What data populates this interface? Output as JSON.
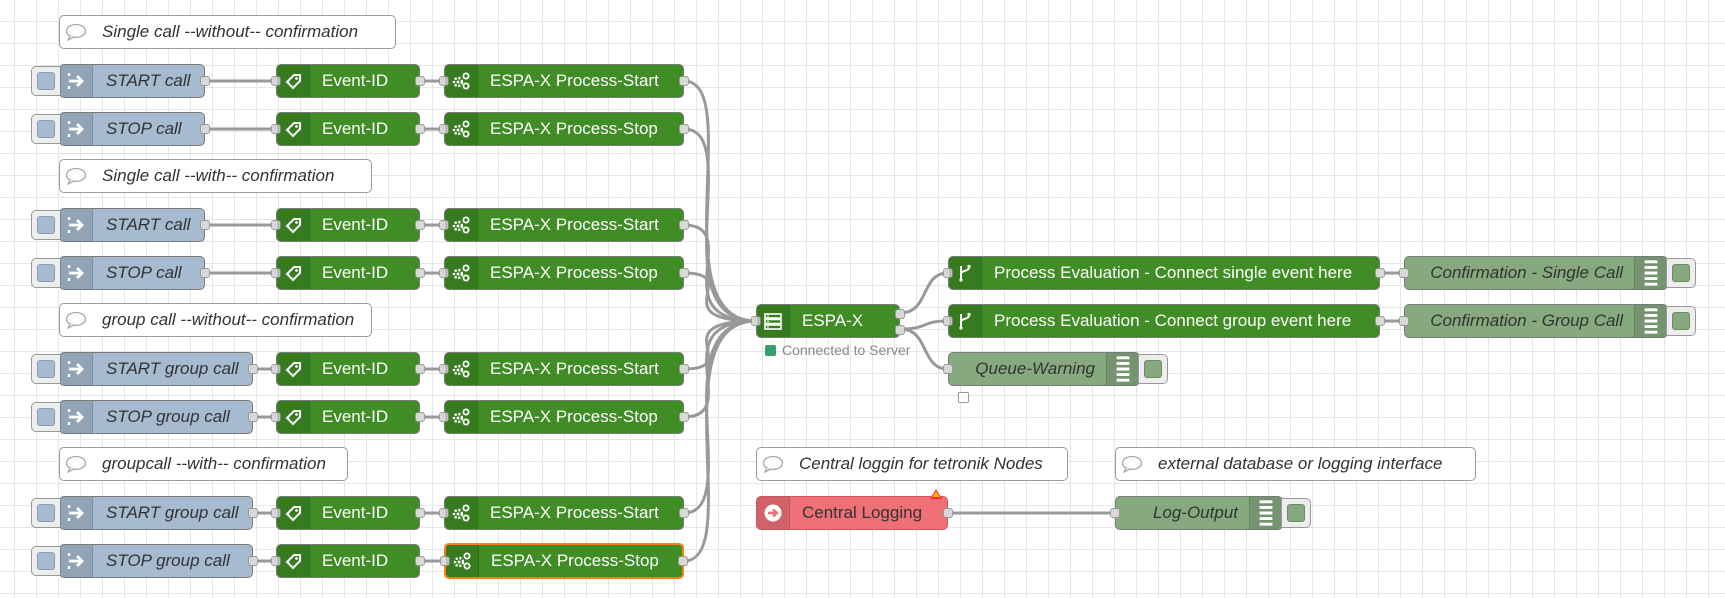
{
  "comments": {
    "c1": "Single call --without-- confirmation",
    "c2": "Single call --with-- confirmation",
    "c3": "group call --without-- confirmation",
    "c4": "groupcall --with-- confirmation",
    "c5": "Central loggin for tetronik Nodes",
    "c6": "external database or logging interface"
  },
  "inject": {
    "start_call": "START call",
    "stop_call": "STOP call",
    "start_group": "START group call",
    "stop_group": "STOP group call"
  },
  "function": {
    "event_id": "Event-ID",
    "process_start": "ESPA-X Process-Start",
    "process_stop": "ESPA-X Process-Stop"
  },
  "espa": {
    "label": "ESPA-X",
    "status": "Connected to Server"
  },
  "switch": {
    "single": "Process Evaluation - Connect single event here",
    "group": "Process Evaluation - Connect group event here"
  },
  "debug": {
    "confirm_single": "Confirmation - Single Call",
    "confirm_group": "Confirmation - Group Call",
    "queue_warning": "Queue-Warning",
    "log_output": "Log-Output"
  },
  "logging": {
    "central": "Central Logging"
  },
  "colors": {
    "inject": "#a6bbcf",
    "function": "#3f8d24",
    "debug": "#87a980",
    "catch": "#f07078",
    "selected": "#ff7f0e",
    "status_connected": "#3a9f6e"
  }
}
